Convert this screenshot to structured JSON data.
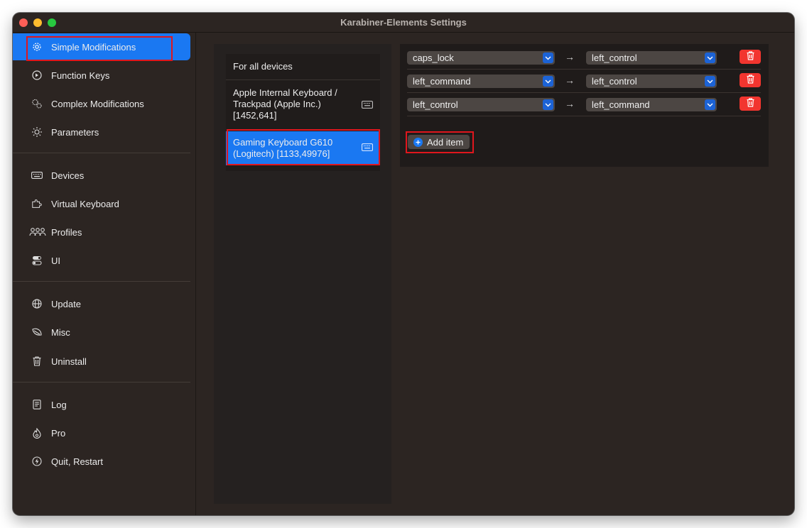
{
  "window": {
    "title": "Karabiner-Elements Settings"
  },
  "sidebar": {
    "items": [
      {
        "label": "Simple Modifications",
        "icon": "gear-icon",
        "selected": true
      },
      {
        "label": "Function Keys",
        "icon": "function-icon"
      },
      {
        "label": "Complex Modifications",
        "icon": "gears-icon"
      },
      {
        "label": "Parameters",
        "icon": "sun-icon"
      },
      {
        "label": "Devices",
        "icon": "keyboard-icon"
      },
      {
        "label": "Virtual Keyboard",
        "icon": "puzzle-icon"
      },
      {
        "label": "Profiles",
        "icon": "people-icon"
      },
      {
        "label": "UI",
        "icon": "toggles-icon"
      },
      {
        "label": "Update",
        "icon": "globe-icon"
      },
      {
        "label": "Misc",
        "icon": "leaf-icon"
      },
      {
        "label": "Uninstall",
        "icon": "trash-icon"
      },
      {
        "label": "Log",
        "icon": "document-icon"
      },
      {
        "label": "Pro",
        "icon": "flame-icon"
      },
      {
        "label": "Quit, Restart",
        "icon": "bolt-icon"
      }
    ]
  },
  "devices": {
    "items": [
      {
        "lines": [
          "For all devices"
        ]
      },
      {
        "lines": [
          "Apple Internal Keyboard /",
          "Trackpad (Apple Inc.)",
          "[1452,641]"
        ],
        "icon": "keyboard-icon"
      },
      {
        "lines": [
          "Gaming Keyboard G610",
          "(Logitech) [1133,49976]"
        ],
        "icon": "keyboard-icon",
        "selected": true
      }
    ]
  },
  "mappings": {
    "rows": [
      {
        "from": "caps_lock",
        "to": "left_control"
      },
      {
        "from": "left_command",
        "to": "left_control"
      },
      {
        "from": "left_control",
        "to": "left_command"
      }
    ],
    "arrow": "→",
    "add_label": "Add item"
  },
  "colors": {
    "accent": "#1a78f2",
    "delete": "#f2352f",
    "highlight": "#e0161d"
  }
}
